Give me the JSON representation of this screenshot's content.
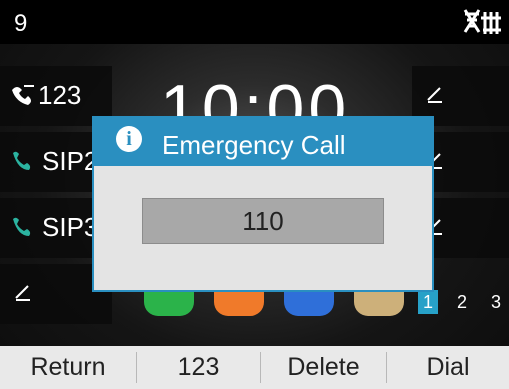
{
  "status": {
    "line_number": "9",
    "network_icon": "network-disconnected-icon"
  },
  "line_keys_left": [
    {
      "label": "123",
      "icon": "line-handset-icon"
    },
    {
      "label": "SIP2",
      "icon": "phone-icon"
    },
    {
      "label": "SIP3",
      "icon": "phone-icon"
    },
    {
      "label": "",
      "icon": "pen-icon"
    }
  ],
  "line_keys_right": [
    {
      "icon": "pen-icon"
    },
    {
      "icon": "pen-icon"
    },
    {
      "icon": "pen-icon"
    }
  ],
  "clock": {
    "time": "10:00"
  },
  "apps": [
    {
      "icon": "phone-app-icon",
      "color": "#2bb34a"
    },
    {
      "icon": "messages-app-icon",
      "color": "#f07a2a"
    },
    {
      "icon": "directory-app-icon",
      "color": "#2f6fd9"
    },
    {
      "icon": "settings-app-icon",
      "color": "#cdb07a"
    }
  ],
  "pages": [
    "1",
    "2",
    "3"
  ],
  "active_page": "1",
  "dialog": {
    "title": "Emergency Call",
    "icon": "info-icon",
    "input_value": "110"
  },
  "softkeys": {
    "return": "Return",
    "input_mode": "123",
    "delete": "Delete",
    "dial": "Dial"
  },
  "colors": {
    "accent": "#2a8fc0",
    "softkey_bar": "#e9e9e9",
    "page_active": "#27a1c8"
  }
}
